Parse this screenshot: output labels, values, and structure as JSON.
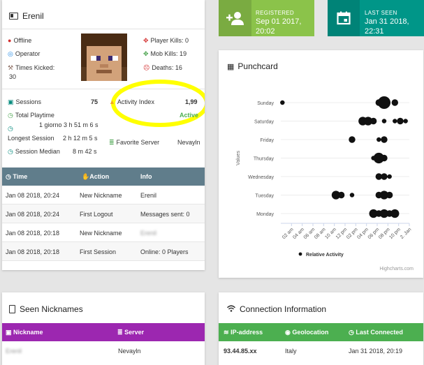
{
  "player": {
    "name": "Erenil",
    "status": "Offline",
    "role": "Operator",
    "times_kicked_label": "Times Kicked:",
    "times_kicked_value": "30",
    "player_kills": "Player Kills: 0",
    "mob_kills": "Mob Kills: 19",
    "deaths": "Deaths: 16"
  },
  "stats": {
    "sessions_label": "Sessions",
    "sessions_value": "75",
    "activity_label": "Activity Index",
    "activity_value": "1,99",
    "activity_status": "Active",
    "playtime_label": "Total Playtime",
    "playtime_value": "1 giorno 3 h 51 m 6 s",
    "longest_label": "Longest Session",
    "longest_value": "2 h 12 m 5 s",
    "median_label": "Session Median",
    "median_value": "8 m 42 s",
    "favorite_label": "Favorite Server",
    "favorite_value": "Nevayln"
  },
  "actions_table": {
    "headers": [
      "Time",
      "Action",
      "Info"
    ],
    "rows": [
      [
        "Jan 08 2018, 20:24",
        "New Nickname",
        "Erenil"
      ],
      [
        "Jan 08 2018, 20:24",
        "First Logout",
        "Messages sent: 0"
      ],
      [
        "Jan 08 2018, 20:18",
        "New Nickname",
        "Erenil"
      ],
      [
        "Jan 08 2018, 20:18",
        "First Session",
        "Online: 0 Players"
      ]
    ]
  },
  "registered": {
    "label": "REGISTERED",
    "date": "Sep 01 2017,",
    "time": "20:02",
    "color": "#8bc34a"
  },
  "last_seen": {
    "label": "LAST SEEN",
    "date": "Jan 31 2018,",
    "time": "22:31",
    "color": "#009688"
  },
  "punchcard": {
    "title": "Punchcard",
    "credit": "Highcharts.com"
  },
  "chart_data": {
    "type": "scatter",
    "title": "Punchcard",
    "ylabel": "Values",
    "x_ticks": [
      "02 am",
      "04 am",
      "06 am",
      "08 am",
      "10 am",
      "12 pm",
      "02 pm",
      "04 pm",
      "06 pm",
      "08 pm",
      "10 pm",
      "2. Jan"
    ],
    "y_categories": [
      "Sunday",
      "Saturday",
      "Friday",
      "Thursday",
      "Wednesday",
      "Tuesday",
      "Monday"
    ],
    "legend": [
      "Relative Activity"
    ],
    "points": [
      {
        "day": "Sunday",
        "hour": 0,
        "size": 1
      },
      {
        "day": "Sunday",
        "hour": 18,
        "size": 2
      },
      {
        "day": "Sunday",
        "hour": 19,
        "size": 5
      },
      {
        "day": "Sunday",
        "hour": 21,
        "size": 2
      },
      {
        "day": "Saturday",
        "hour": 15,
        "size": 3
      },
      {
        "day": "Saturday",
        "hour": 16,
        "size": 3
      },
      {
        "day": "Saturday",
        "hour": 17,
        "size": 2
      },
      {
        "day": "Saturday",
        "hour": 19,
        "size": 1
      },
      {
        "day": "Saturday",
        "hour": 21,
        "size": 1
      },
      {
        "day": "Saturday",
        "hour": 22,
        "size": 2
      },
      {
        "day": "Saturday",
        "hour": 23,
        "size": 1
      },
      {
        "day": "Friday",
        "hour": 13,
        "size": 2
      },
      {
        "day": "Friday",
        "hour": 18,
        "size": 1
      },
      {
        "day": "Friday",
        "hour": 19,
        "size": 2
      },
      {
        "day": "Thursday",
        "hour": 17,
        "size": 1
      },
      {
        "day": "Thursday",
        "hour": 18,
        "size": 4
      },
      {
        "day": "Thursday",
        "hour": 19,
        "size": 2
      },
      {
        "day": "Wednesday",
        "hour": 18,
        "size": 2
      },
      {
        "day": "Wednesday",
        "hour": 19,
        "size": 2
      },
      {
        "day": "Wednesday",
        "hour": 20,
        "size": 1
      },
      {
        "day": "Tuesday",
        "hour": 10,
        "size": 3
      },
      {
        "day": "Tuesday",
        "hour": 11,
        "size": 2
      },
      {
        "day": "Tuesday",
        "hour": 13,
        "size": 1
      },
      {
        "day": "Tuesday",
        "hour": 18,
        "size": 2
      },
      {
        "day": "Tuesday",
        "hour": 19,
        "size": 3
      },
      {
        "day": "Tuesday",
        "hour": 20,
        "size": 2
      },
      {
        "day": "Monday",
        "hour": 17,
        "size": 3
      },
      {
        "day": "Monday",
        "hour": 18,
        "size": 2
      },
      {
        "day": "Monday",
        "hour": 19,
        "size": 3
      },
      {
        "day": "Monday",
        "hour": 20,
        "size": 2
      },
      {
        "day": "Monday",
        "hour": 21,
        "size": 3
      }
    ]
  },
  "seen_nicknames": {
    "title": "Seen Nicknames",
    "headers": [
      "Nickname",
      "Server"
    ],
    "rows": [
      [
        "Erenil",
        "Nevayln"
      ]
    ],
    "header_color": "#9c27b0"
  },
  "connection_info": {
    "title": "Connection Information",
    "headers": [
      "IP-address",
      "Geolocation",
      "Last Connected"
    ],
    "rows": [
      [
        "93.44.85.xx",
        "Italy",
        "Jan 31 2018, 20:19"
      ]
    ],
    "header_color": "#4caf50"
  },
  "colors": {
    "table_header": "#607d8b",
    "highlight": "#ffff00",
    "active": "#4caf50"
  }
}
